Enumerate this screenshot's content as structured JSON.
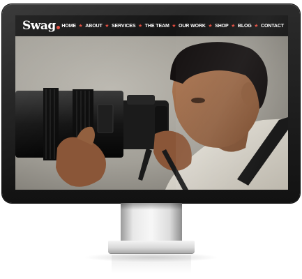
{
  "site": {
    "logo": "Swag",
    "accent_color": "#e34a3c",
    "nav": [
      {
        "label": "HOME"
      },
      {
        "label": "ABOUT"
      },
      {
        "label": "SERVICES"
      },
      {
        "label": "THE TEAM"
      },
      {
        "label": "OUR WORK"
      },
      {
        "label": "SHOP"
      },
      {
        "label": "BLOG"
      },
      {
        "label": "CONTACT"
      }
    ],
    "separator_icon": "star-icon"
  },
  "hero": {
    "image": "photographer-with-camera-lens"
  },
  "device": {
    "type": "desktop-monitor",
    "color": "#1a1a1a"
  }
}
